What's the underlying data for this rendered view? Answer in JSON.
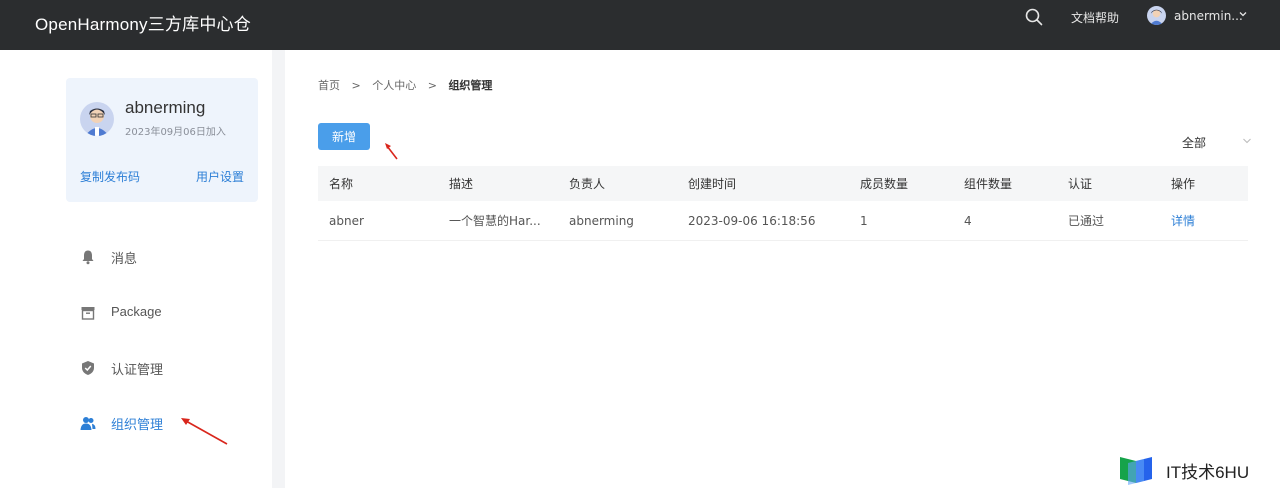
{
  "header": {
    "brand": "OpenHarmony三方库中心仓",
    "docs_label": "文档帮助",
    "user_label": "abnermin..."
  },
  "profile": {
    "name": "abnerming",
    "joined": "2023年09月06日加入",
    "copy_code_label": "复制发布码",
    "user_settings_label": "用户设置"
  },
  "sidebar": {
    "items": [
      {
        "label": "消息",
        "icon": "bell-icon"
      },
      {
        "label": "Package",
        "icon": "package-icon"
      },
      {
        "label": "认证管理",
        "icon": "shield-icon"
      },
      {
        "label": "组织管理",
        "icon": "group-icon",
        "active": true
      }
    ]
  },
  "breadcrumb": [
    "首页",
    ">",
    "个人中心",
    ">",
    "组织管理"
  ],
  "toolbar": {
    "add_label": "新增",
    "filter_value": "全部"
  },
  "table": {
    "columns": [
      "名称",
      "描述",
      "负责人",
      "创建时间",
      "成员数量",
      "组件数量",
      "认证",
      "操作"
    ],
    "rows": [
      [
        "abner",
        "一个智慧的Har...",
        "abnerming",
        "2023-09-06 16:18:56",
        "1",
        "4",
        "已通过",
        "详情"
      ]
    ]
  },
  "watermark": {
    "text": "IT技术6HU"
  },
  "colors": {
    "accent": "#4a9eea",
    "link": "#2d7fd6",
    "topbar": "#2b2d2f",
    "arrow": "#d9261c"
  }
}
